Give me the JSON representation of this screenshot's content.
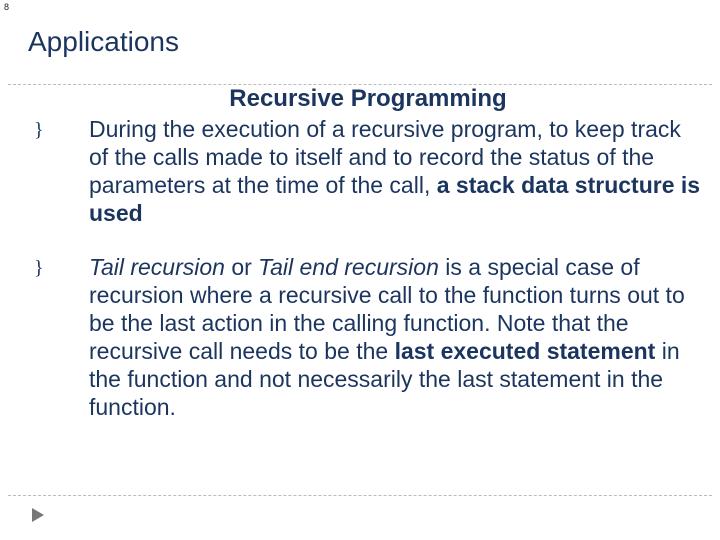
{
  "page_number": "8",
  "title": "Applications",
  "subtitle": "Recursive Programming",
  "bullet_glyph": "}",
  "para1": {
    "lead": "During the execution of a recursive program, to keep track of the calls made to itself and to record the status of the parameters at the time of the call, ",
    "bold": "a stack data structure is used"
  },
  "para2": {
    "em1": "Tail recursion",
    "mid1": " or ",
    "em2": "Tail end recursion",
    "mid2": " is a special case of recursion where a recursive call to the function turns out to be the last action in the calling function. Note that the recursive call needs to  be the ",
    "bold": "last executed statement ",
    "tail": " in the function and  not necessarily the last statement in the function."
  }
}
